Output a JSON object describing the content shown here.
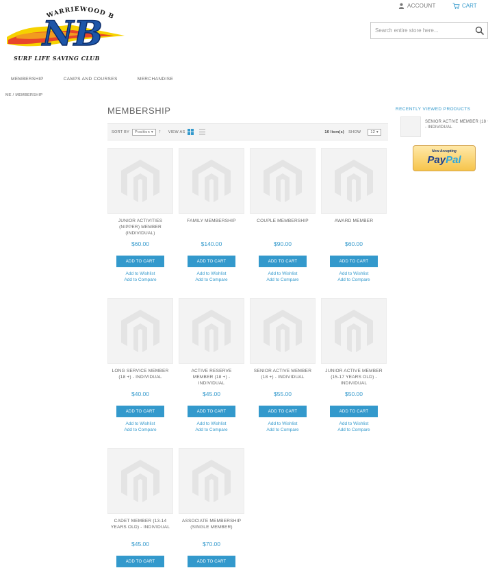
{
  "header": {
    "account_label": "ACCOUNT",
    "cart_label": "CART",
    "search_placeholder": "Search entire store here...",
    "logo_top_text": "WARRIEWOOD BEACH",
    "logo_bottom_text": "SURF LIFE SAVING CLUB",
    "logo_initials": "NB"
  },
  "nav": {
    "items": [
      "MEMBERSHIP",
      "CAMPS AND COURSES",
      "MERCHANDISE"
    ]
  },
  "breadcrumb": {
    "text": "ME / MEMBERSHIP"
  },
  "page": {
    "title": "MEMBERSHIP"
  },
  "toolbar": {
    "sort_label": "SORT BY",
    "sort_value": "Position",
    "view_label": "VIEW AS",
    "count_text": "10 Item(s)",
    "show_label": "SHOW",
    "show_value": "12"
  },
  "product_actions": {
    "add_to_cart": "ADD TO CART",
    "add_to_wishlist": "Add to Wishlist",
    "add_to_compare": "Add to Compare"
  },
  "products": [
    {
      "name": "JUNIOR ACTIVITIES (NIPPER) MEMBER (INDIVIDUAL)",
      "price": "$60.00"
    },
    {
      "name": "FAMILY MEMBERSHIP",
      "price": "$140.00"
    },
    {
      "name": "COUPLE MEMBERSHIP",
      "price": "$90.00"
    },
    {
      "name": "AWARD MEMBER",
      "price": "$60.00"
    },
    {
      "name": "LONG SERVICE MEMBER (18 +) - INDIVIDUAL",
      "price": "$40.00"
    },
    {
      "name": "ACTIVE RESERVE MEMBER (18 +) - INDIVIDUAL",
      "price": "$45.00"
    },
    {
      "name": "SENIOR ACTIVE MEMBER (18 +) - INDIVIDUAL",
      "price": "$55.00"
    },
    {
      "name": "JUNIOR ACTIVE MEMBER (15-17 YEARS OLD) - INDIVIDUAL",
      "price": "$50.00"
    },
    {
      "name": "CADET MEMBER (13-14 YEARS OLD) - INDIVIDUAL",
      "price": "$45.00"
    },
    {
      "name": "ASSOCIATE MEMBERSHIP (SINGLE MEMBER)",
      "price": "$70.00"
    }
  ],
  "sidebar": {
    "recently_viewed_title": "RECENTLY VIEWED PRODUCTS",
    "recent_item_name": "SENIOR ACTIVE MEMBER (18 +) - INDIVIDUAL",
    "paypal_top": "Now Accepting",
    "paypal_logo_pay": "Pay",
    "paypal_logo_pal": "Pal"
  },
  "colors": {
    "accent": "#3399cc",
    "text": "#636363"
  }
}
